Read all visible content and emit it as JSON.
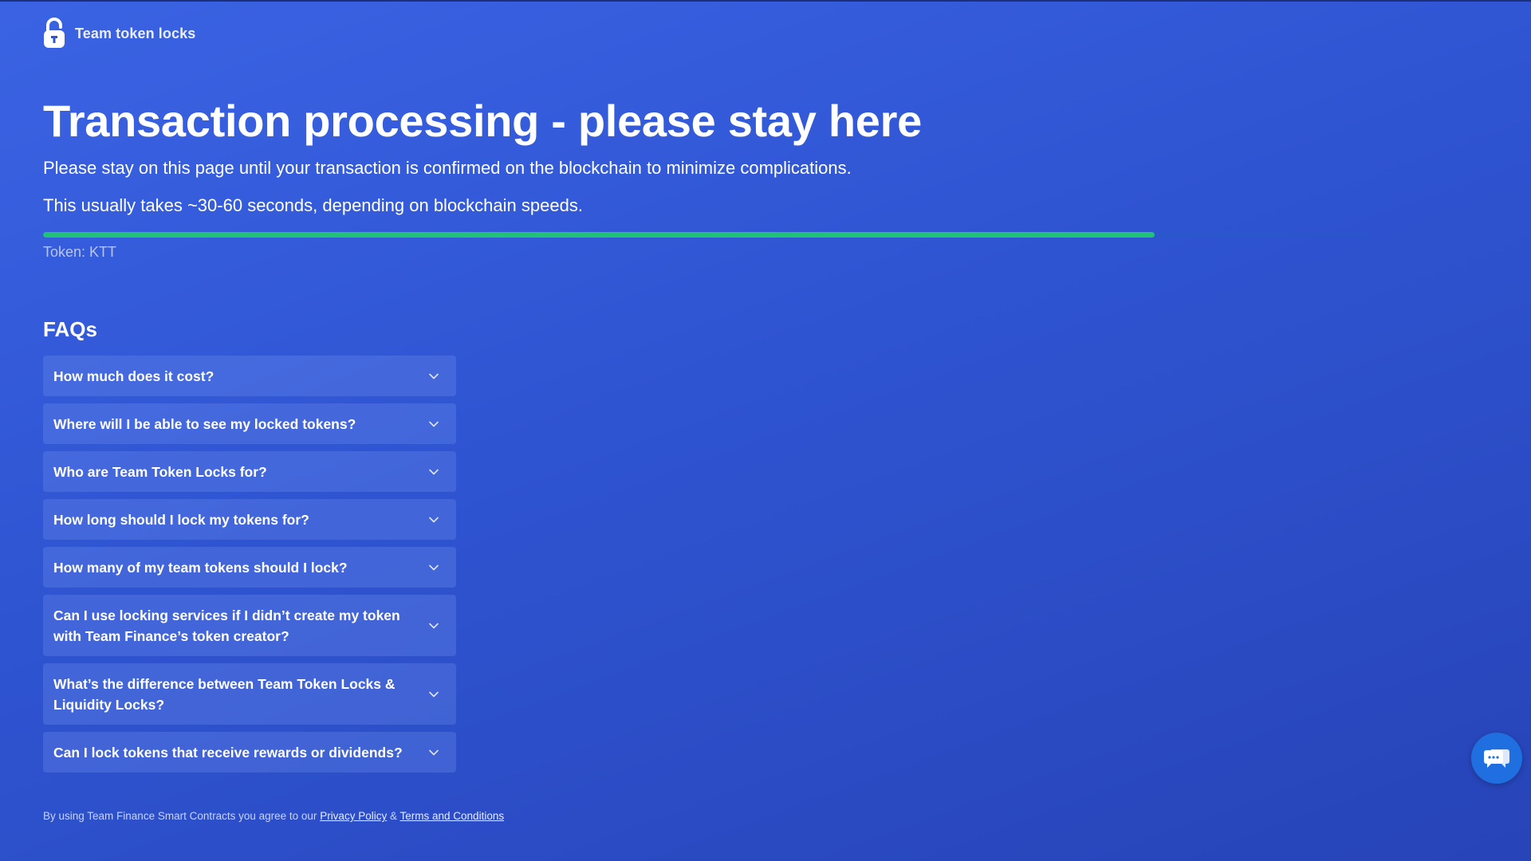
{
  "brand": {
    "name": "Team token locks",
    "icon": "padlock-icon"
  },
  "main": {
    "title": "Transaction processing - please stay here",
    "subtitle_1": "Please stay on this page until your transaction is confirmed on the blockchain to minimize complications.",
    "subtitle_2": "This usually takes ~30-60 seconds, depending on blockchain speeds.",
    "progress": 0.84,
    "token_label": "Token: KTT"
  },
  "faq": {
    "heading": "FAQs",
    "items": [
      {
        "question": "How much does it cost?"
      },
      {
        "question": "Where will I be able to see my locked tokens?"
      },
      {
        "question": "Who are Team Token Locks for?"
      },
      {
        "question": "How long should I lock my tokens for?"
      },
      {
        "question": "How many of my team tokens should I lock?"
      },
      {
        "question": "Can I use locking services if I didn’t create my token with Team Finance’s token creator?"
      },
      {
        "question": "What’s the difference between Team Token Locks & Liquidity Locks?"
      },
      {
        "question": "Can I lock tokens that receive rewards or dividends?"
      }
    ]
  },
  "footer": {
    "text": "By using Team Finance Smart Contracts you agree to our",
    "privacy_link": "Privacy Policy",
    "separator": "&",
    "terms_link": "Terms and Conditions"
  },
  "chat": {
    "icon": "chat-bubbles-icon"
  },
  "colors": {
    "background": "#2f54d2",
    "progress_fill": "#22c17a",
    "chat_button": "#1f6fe0"
  }
}
